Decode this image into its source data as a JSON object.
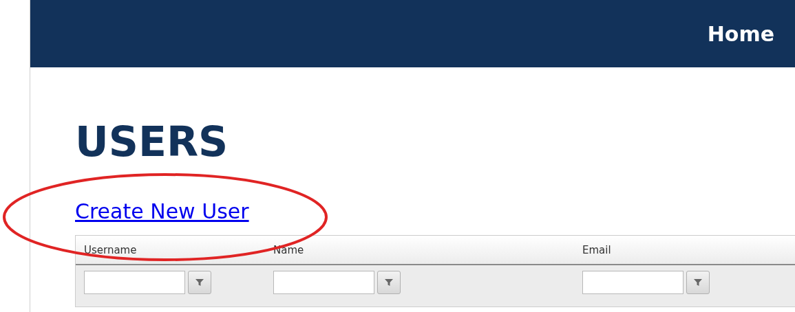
{
  "nav": {
    "items": [
      "Home"
    ]
  },
  "page": {
    "title": "USERS",
    "create_link": "Create New User"
  },
  "table": {
    "columns": [
      {
        "label": "Username"
      },
      {
        "label": "Name"
      },
      {
        "label": "Email"
      }
    ]
  },
  "annotation": {
    "kind": "ellipse",
    "color": "#e02424"
  }
}
